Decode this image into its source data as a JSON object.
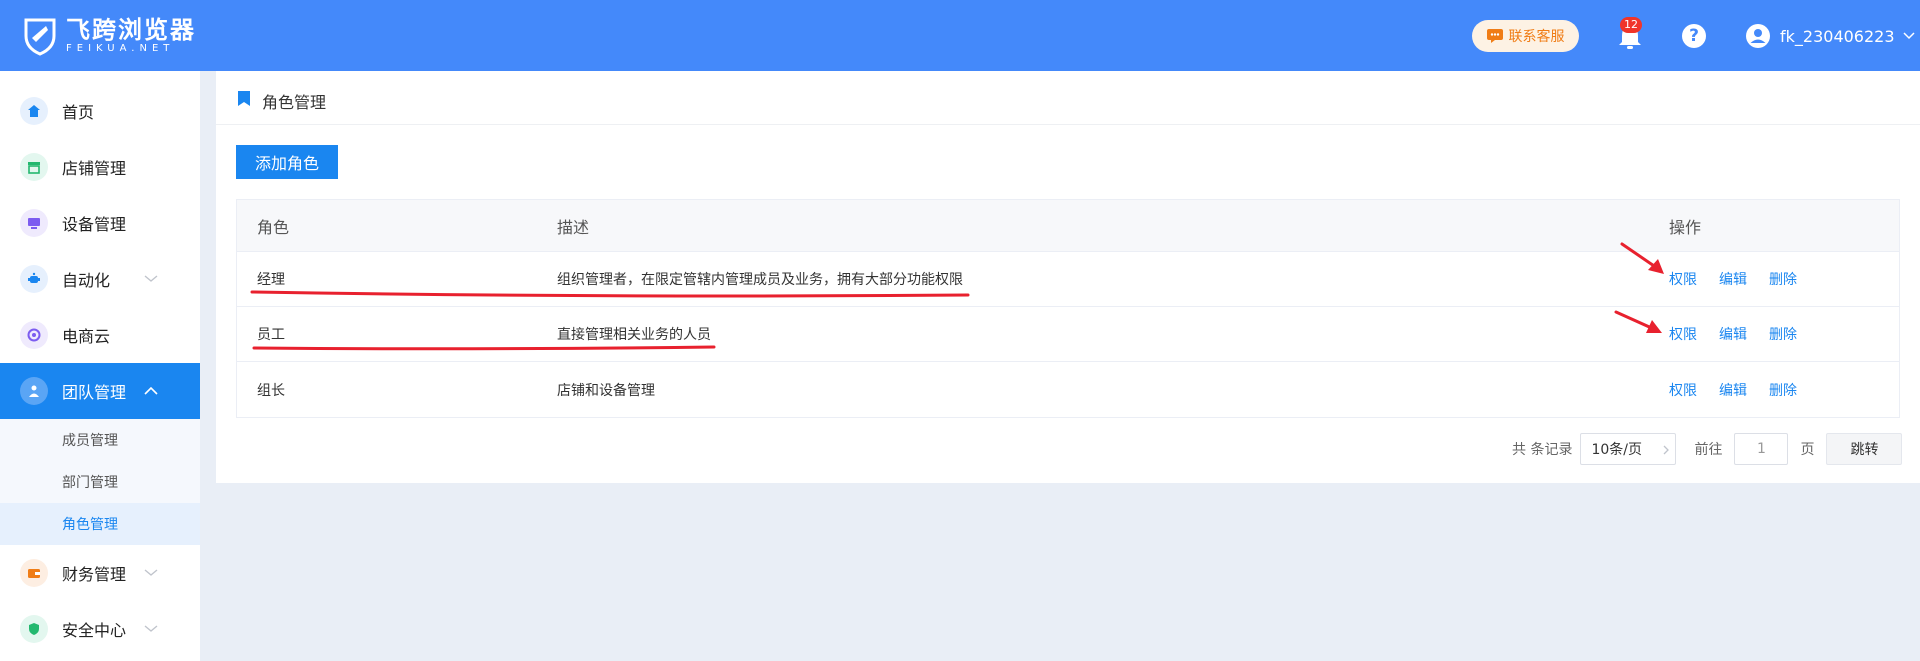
{
  "brand": {
    "name_cn": "飞跨浏览器",
    "name_en": "FEIKUA.NET"
  },
  "header": {
    "support_label": "联系客服",
    "notification_count": "12",
    "help_symbol": "?",
    "username": "fk_230406223"
  },
  "sidebar": {
    "items": [
      {
        "label": "首页",
        "icon": "home-icon"
      },
      {
        "label": "店铺管理",
        "icon": "store-icon"
      },
      {
        "label": "设备管理",
        "icon": "device-icon"
      },
      {
        "label": "自动化",
        "icon": "robot-icon"
      },
      {
        "label": "电商云",
        "icon": "cloud-icon"
      },
      {
        "label": "团队管理",
        "icon": "team-icon"
      },
      {
        "label": "财务管理",
        "icon": "wallet-icon"
      },
      {
        "label": "安全中心",
        "icon": "shield-icon"
      }
    ],
    "sub_items": [
      "成员管理",
      "部门管理",
      "角色管理"
    ]
  },
  "page": {
    "title": "角色管理",
    "add_button": "添加角色"
  },
  "table": {
    "headers": {
      "role": "角色",
      "desc": "描述",
      "ops": "操作"
    },
    "rows": [
      {
        "role": "经理",
        "desc": "组织管理者，在限定管辖内管理成员及业务，拥有大部分功能权限"
      },
      {
        "role": "员工",
        "desc": "直接管理相关业务的人员"
      },
      {
        "role": "组长",
        "desc": "店铺和设备管理"
      }
    ],
    "actions": {
      "permission": "权限",
      "edit": "编辑",
      "delete": "删除"
    }
  },
  "pager": {
    "total_label": "共 条记录",
    "page_size": "10条/页",
    "goto_label": "前往",
    "page_value": "1",
    "page_unit": "页",
    "jump_label": "跳转"
  },
  "colors": {
    "header_bg": "#4489fa",
    "primary": "#1a86f0",
    "annotation_red": "#e8212e"
  }
}
